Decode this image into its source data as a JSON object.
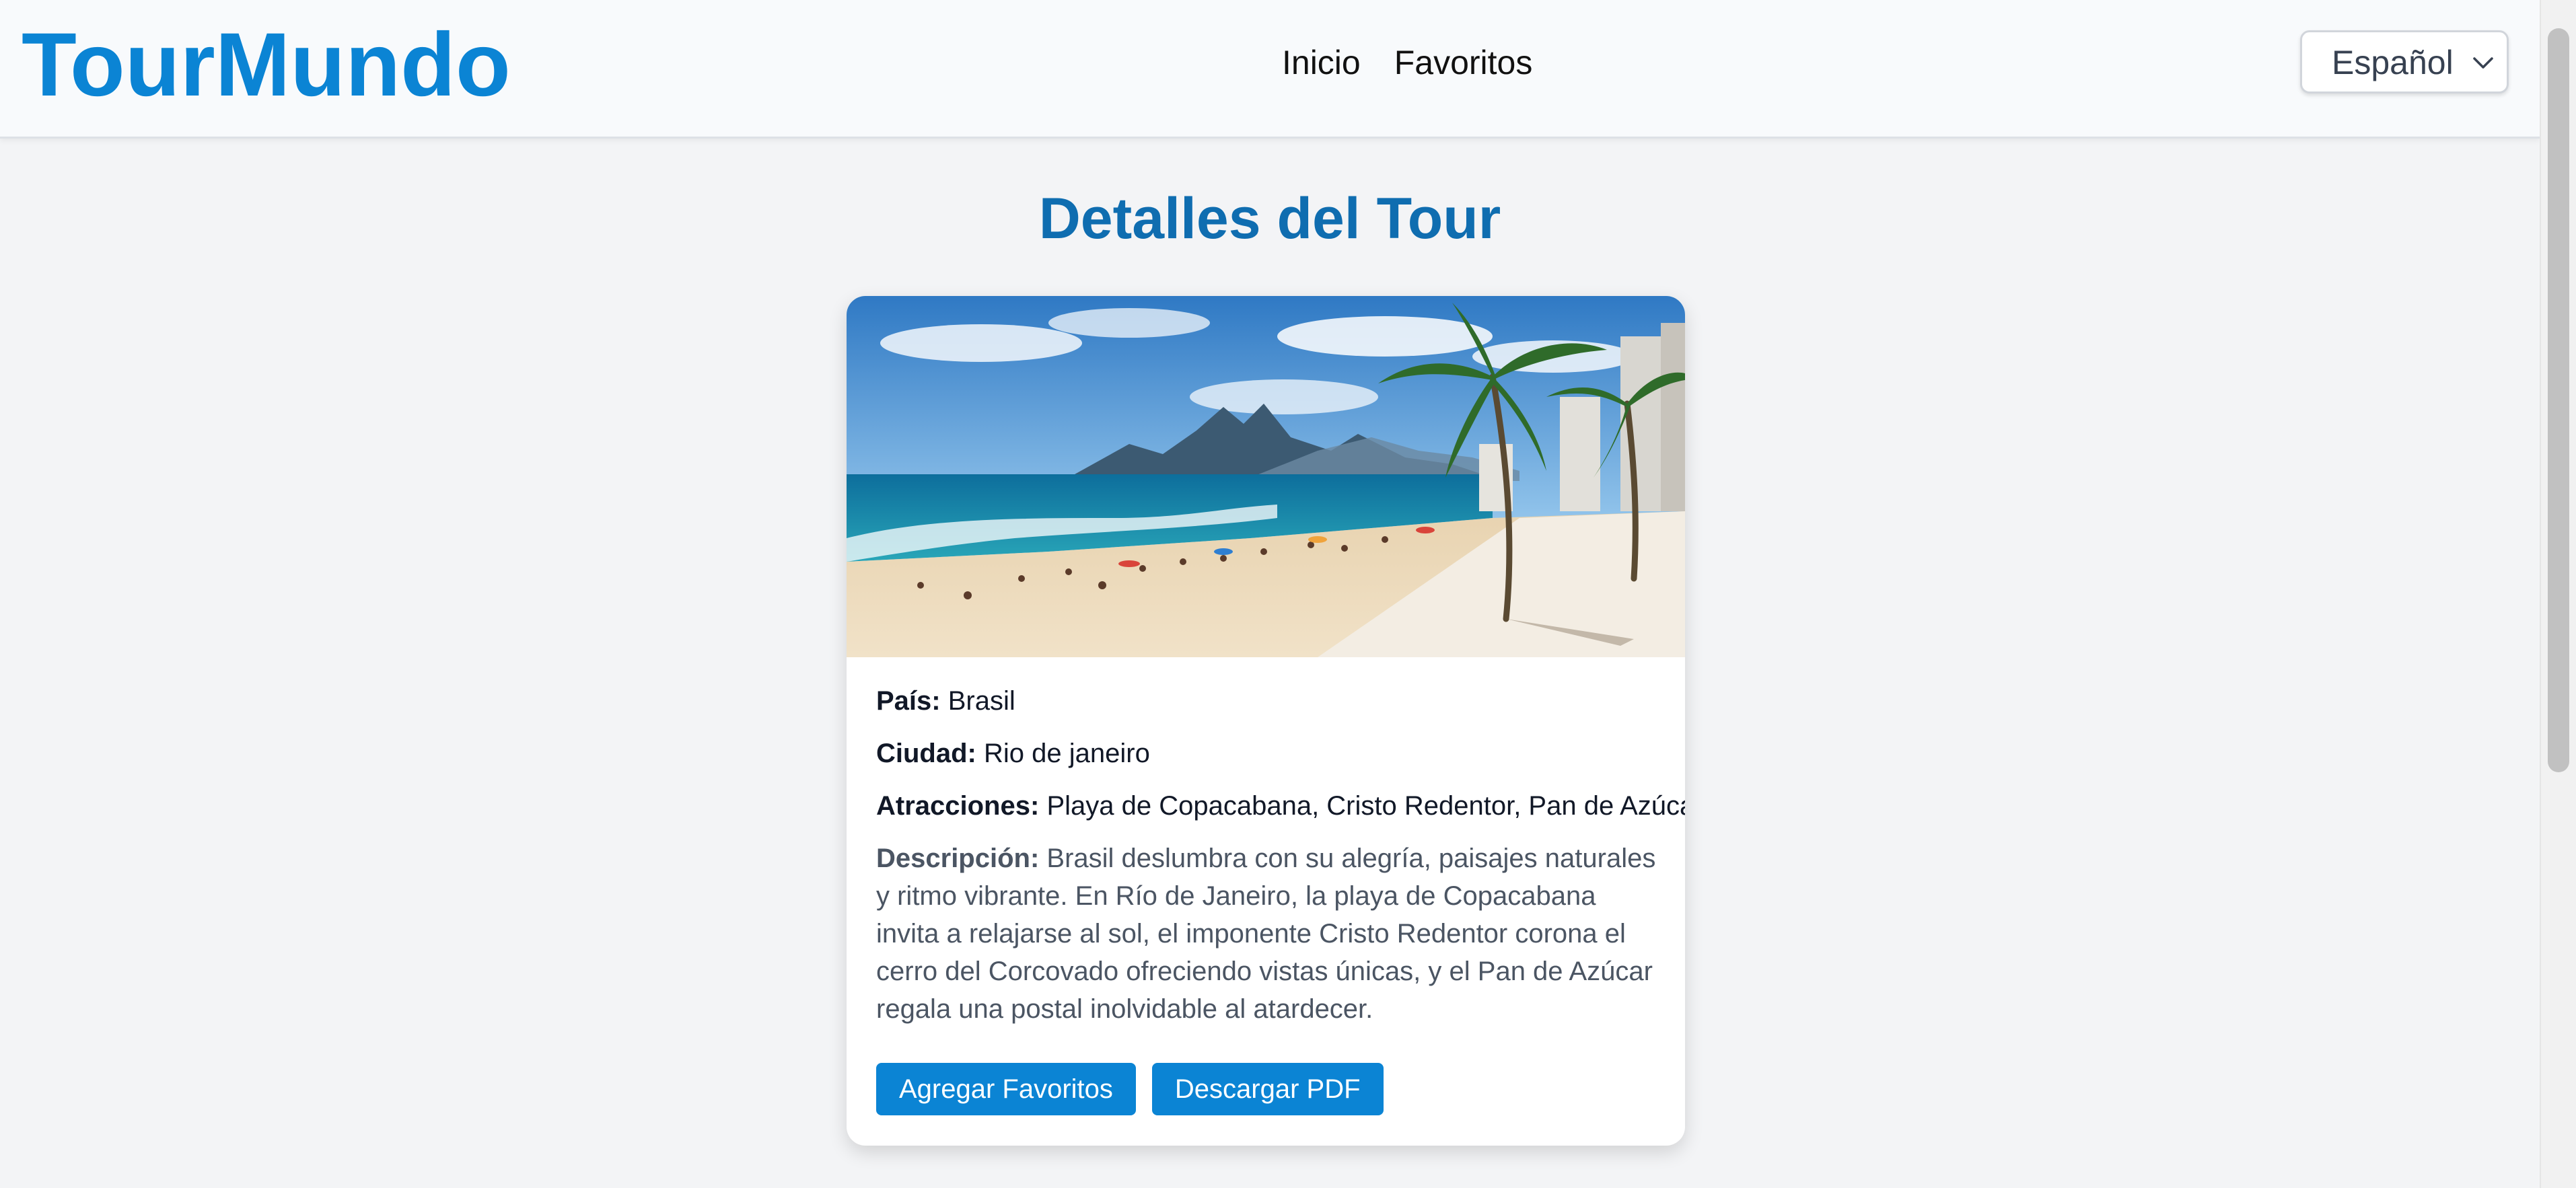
{
  "header": {
    "logo": "TourMundo",
    "nav": [
      {
        "label": "Inicio"
      },
      {
        "label": "Favoritos"
      }
    ],
    "language": {
      "selected": "Español",
      "icon": "chevron-down-icon"
    }
  },
  "main": {
    "title": "Detalles del Tour",
    "card": {
      "image": {
        "subject": "beach-photo",
        "scene": "Playa de Copacabana"
      },
      "country_label": "País:",
      "country": "Brasil",
      "city_label": "Ciudad:",
      "city": "Rio de janeiro",
      "attractions_label": "Atracciones:",
      "attractions": "Playa de Copacabana, Cristo Redentor, Pan de Azúcar",
      "description_label": "Descripción:",
      "description": "Brasil deslumbra con su alegría, paisajes naturales y ritmo vibrante. En Río de Janeiro, la playa de Copacabana invita a relajarse al sol, el imponente Cristo Redentor corona el cerro del Corcovado ofreciendo vistas únicas, y el Pan de Azúcar regala una postal inolvidable al atardecer.",
      "buttons": {
        "add_favorites": "Agregar Favoritos",
        "download_pdf": "Descargar PDF"
      }
    }
  },
  "colors": {
    "brand": "#0b84d4",
    "title": "#0f6db0",
    "background": "#f3f4f6"
  }
}
